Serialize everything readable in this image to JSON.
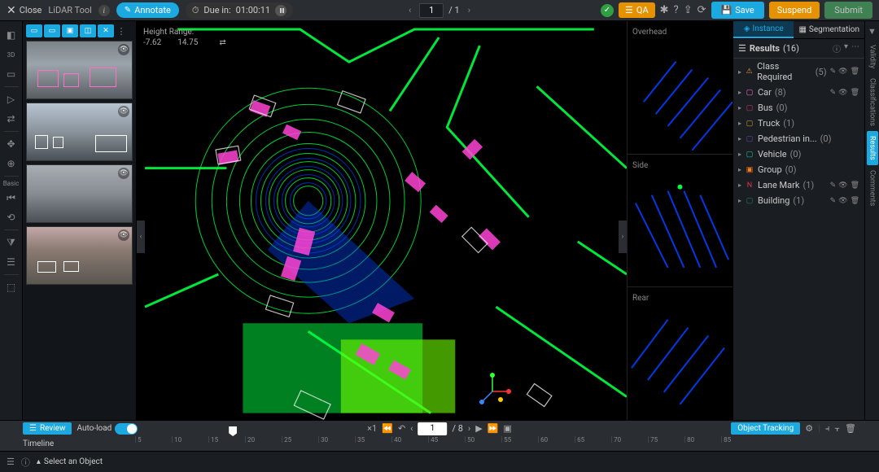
{
  "header": {
    "close": "Close",
    "tool_name": "LiDAR Tool",
    "annotate": "Annotate",
    "due_prefix": "Due in:",
    "due_time": "01:00:11",
    "page_current": "1",
    "page_total": "/ 1",
    "qa": "QA",
    "save": "Save",
    "suspend": "Suspend",
    "submit": "Submit"
  },
  "far_left": {
    "tool3d": "3D",
    "basic_label": "Basic"
  },
  "viewport": {
    "height_range_label": "Height Range:",
    "range_min": "-7.62",
    "range_max": "14.75"
  },
  "side_views": {
    "overhead": "Overhead",
    "side": "Side",
    "rear": "Rear"
  },
  "panel": {
    "tab_instance": "Instance",
    "tab_segmentation": "Segmentation",
    "results_title": "Results",
    "results_count": "(16)",
    "items": [
      {
        "icon": "warn",
        "label": "Class Required",
        "count": "(5)",
        "actions": true
      },
      {
        "icon": "car",
        "label": "Car",
        "count": "(8)",
        "actions": true
      },
      {
        "icon": "bus",
        "label": "Bus",
        "count": "(0)",
        "actions": false
      },
      {
        "icon": "truck",
        "label": "Truck",
        "count": "(1)",
        "actions": false
      },
      {
        "icon": "ped",
        "label": "Pedestrian in...",
        "count": "(0)",
        "actions": false
      },
      {
        "icon": "veh",
        "label": "Vehicle",
        "count": "(0)",
        "actions": false
      },
      {
        "icon": "grp",
        "label": "Group",
        "count": "(0)",
        "actions": false
      },
      {
        "icon": "lane",
        "label": "Lane Mark",
        "count": "(1)",
        "actions": true
      },
      {
        "icon": "bld",
        "label": "Building",
        "count": "(1)",
        "actions": true
      }
    ]
  },
  "far_right": {
    "validity": "Validity",
    "classifications": "Classifications",
    "results": "Results",
    "comments": "Comments"
  },
  "bottom": {
    "review": "Review",
    "autoload": "Auto-load",
    "frame_current": "1",
    "frame_total": "/ 8",
    "object_tracking": "Object Tracking",
    "timeline": "Timeline",
    "ticks": [
      "5",
      "10",
      "15",
      "20",
      "25",
      "30",
      "35",
      "40",
      "45",
      "50",
      "55",
      "60",
      "65",
      "70",
      "75",
      "80",
      "85"
    ]
  },
  "status": {
    "select_object": "Select an Object"
  }
}
